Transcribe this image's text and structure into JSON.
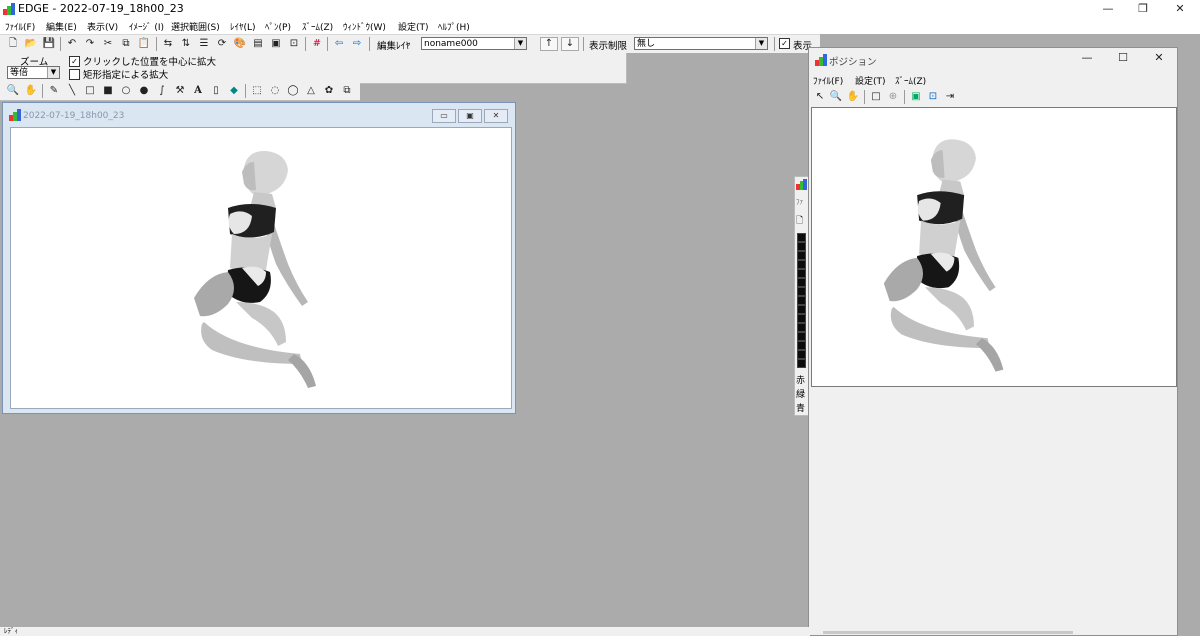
{
  "app": {
    "title": "EDGE - 2022-07-19_18h00_23",
    "controls": {
      "minimize": "—",
      "restore": "❐",
      "close": "✕"
    }
  },
  "menubar": [
    "ﾌｧｲﾙ(F)",
    "編集(E)",
    "表示(V)",
    "ｲﾒｰｼﾞ (I)",
    "選択範囲(S)",
    "ﾚｲﾔ(L)",
    "ﾍﾟﾝ(P)",
    "ｽﾞｰﾑ(Z)",
    "ｳｨﾝﾄﾞｳ(W)",
    "設定(T)",
    "ﾍﾙﾌﾟ(H)"
  ],
  "toolbar": {
    "edit_layer_label": "編集ﾚｲﾔ",
    "edit_layer_value": "noname000",
    "up_arrow": "↑",
    "down_arrow": "↓",
    "display_limit_label": "表示制限",
    "display_limit_value": "無し",
    "display_checkbox_label": "表示",
    "icons": [
      "new-file-icon",
      "open-folder-icon",
      "save-icon",
      "undo-icon",
      "redo-icon",
      "cut-icon",
      "copy-icon",
      "paste-icon",
      "flip-h-icon",
      "flip-v-icon",
      "layers-icon",
      "rotate-icon",
      "palette-icon",
      "film-icon",
      "image-icon",
      "frame-icon",
      "grid-icon",
      "prev-frame-icon",
      "next-frame-icon"
    ]
  },
  "zoom_panel": {
    "title": "ズーム",
    "zoom_value": "等倍",
    "option_center": "クリックした位置を中心に拡大",
    "option_center_checked": true,
    "option_rect": "矩形指定による拡大",
    "option_rect_checked": false
  },
  "tools": [
    "magnifier-icon",
    "hand-icon",
    "pen-icon",
    "line-icon",
    "rect-icon",
    "filled-rect-icon",
    "circle-icon",
    "filled-circle-icon",
    "curve-icon",
    "hammer-icon",
    "text-icon",
    "eraser-icon",
    "fill-bucket-icon",
    "rect-select-icon",
    "ellipse-select-icon",
    "lasso-icon",
    "polygon-select-icon",
    "magic-select-icon",
    "move-select-icon"
  ],
  "canvas_window": {
    "title": "2022-07-19_18h00_23",
    "controls": {
      "minimize": "▭",
      "maximize": "▣",
      "close": "✕"
    }
  },
  "palette": {
    "labels": [
      "赤",
      "緑",
      "青"
    ],
    "header": "ﾌｧ",
    "swatch_count": 15
  },
  "position_window": {
    "title": "ポジション",
    "menu": [
      "ﾌｧｲﾙ(F)",
      "設定(T)",
      "ｽﾞｰﾑ(Z)"
    ],
    "controls": {
      "minimize": "—",
      "maximize": "☐",
      "close": "✕"
    },
    "tools": [
      "pointer-icon",
      "magnifier-icon",
      "hand-icon",
      "rect-icon",
      "crosshair-icon",
      "image-icon",
      "fit-icon",
      "move-icon"
    ]
  },
  "status": {
    "text": "ﾚﾃﾞｨ"
  }
}
